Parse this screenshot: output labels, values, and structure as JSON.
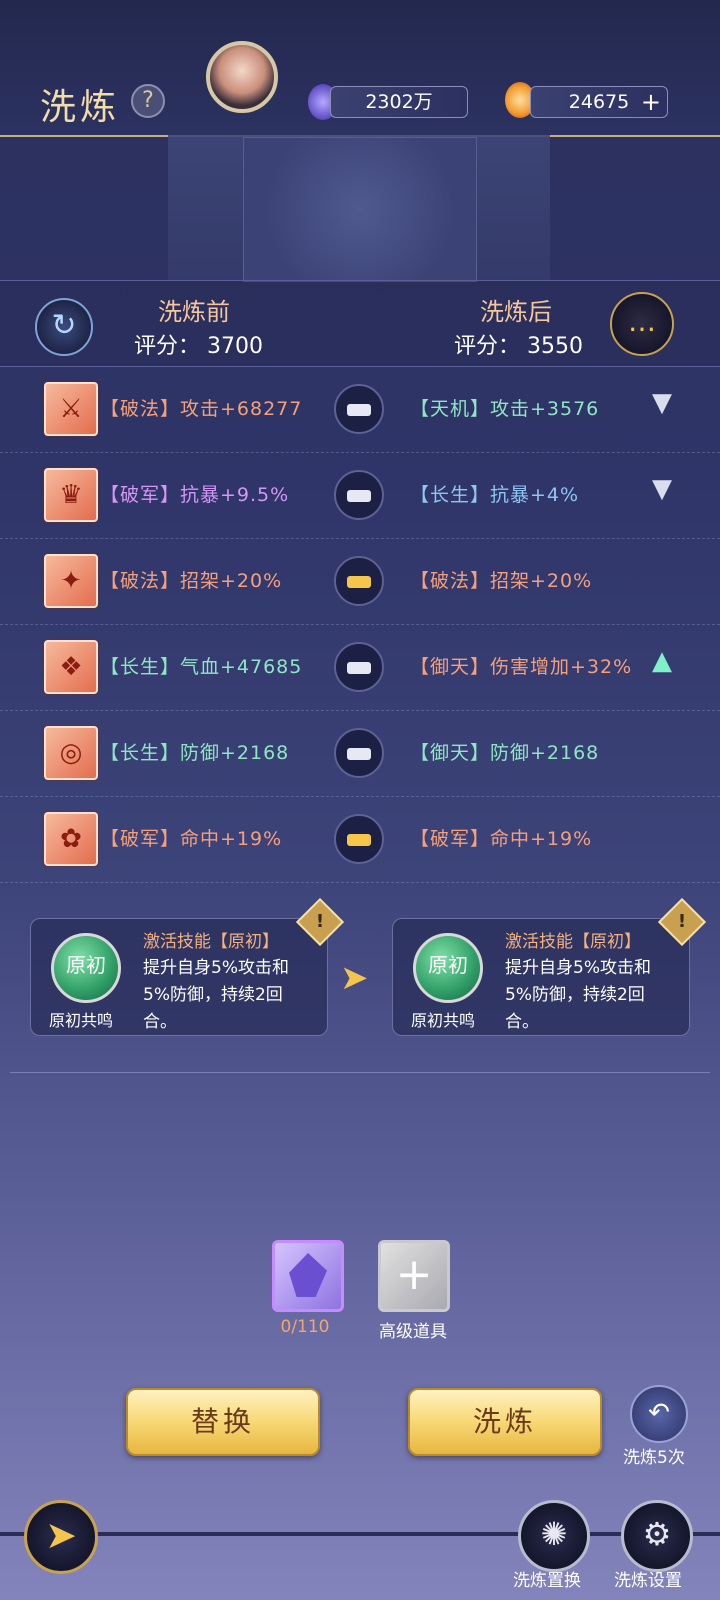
{
  "header": {
    "title": "洗炼",
    "help_symbol": "?",
    "resource_1_value": "2302万",
    "resource_2_value": "24675",
    "resource_2_add": "+"
  },
  "compare": {
    "before_title": "洗炼前",
    "before_score": "评分： 3700",
    "after_title": "洗炼后",
    "after_score": "评分： 3550"
  },
  "rows": [
    {
      "before": "【破法】攻击+68277",
      "after": "【天机】攻击+3576",
      "trend": "▼"
    },
    {
      "before": "【破军】抗暴+9.5%",
      "after": "【长生】抗暴+4%",
      "trend": "▼"
    },
    {
      "before": "【破法】招架+20%",
      "after": "【破法】招架+20%",
      "trend": ""
    },
    {
      "before": "【长生】气血+47685",
      "after": "【御天】伤害增加+32%",
      "trend": "▲"
    },
    {
      "before": "【长生】防御+2168",
      "after": "【御天】防御+2168",
      "trend": ""
    },
    {
      "before": "【破军】命中+19%",
      "after": "【破军】命中+19%",
      "trend": ""
    }
  ],
  "skills": {
    "before": {
      "title": "激活技能【原初】",
      "desc": "提升自身5%攻击和5%防御，持续2回合。",
      "orb_text": "原初",
      "name": "原初共鸣"
    },
    "after": {
      "title": "激活技能【原初】",
      "desc": "提升自身5%攻击和5%防御，持续2回合。",
      "orb_text": "原初",
      "name": "原初共鸣"
    },
    "warn_symbol": "!"
  },
  "items": {
    "crystal_count": "0/110",
    "advanced_label": "高级道具"
  },
  "buttons": {
    "replace": "替换",
    "refine": "洗炼",
    "refine5_label": "洗炼5次",
    "swap_label": "洗炼置换",
    "settings_label": "洗炼设置"
  },
  "colors": {
    "accent_gold": "#f4c54d",
    "score_title": "#f6c79b"
  }
}
